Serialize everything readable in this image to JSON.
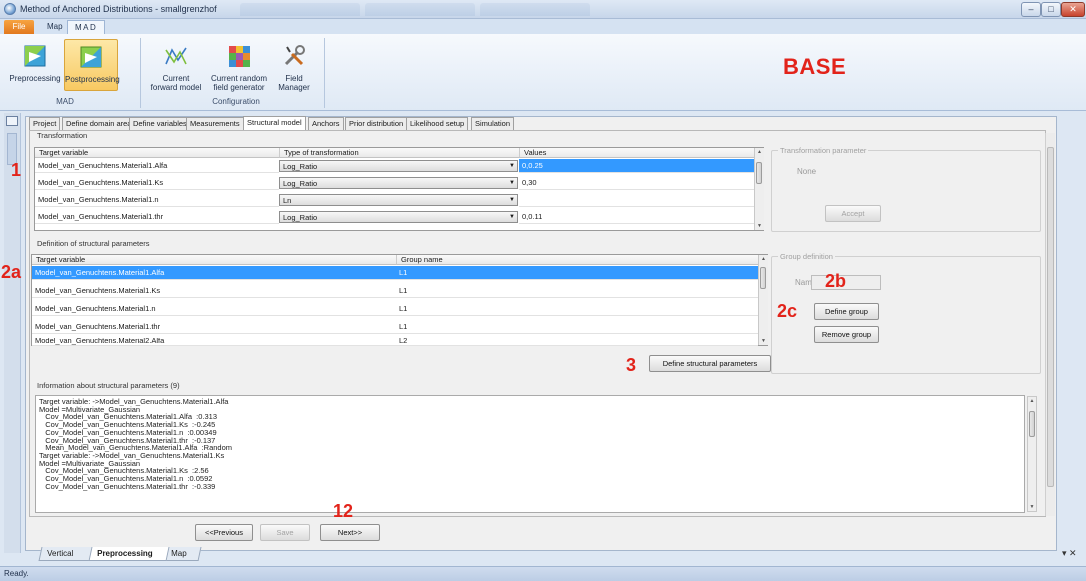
{
  "window": {
    "title": "Method of Anchored Distributions - smallgrenzhof",
    "controls": {
      "minimize": "–",
      "maximize": "□",
      "close": "✕"
    }
  },
  "menu": {
    "file": "File",
    "map": "Map",
    "mad": "MAD"
  },
  "ribbon": {
    "preprocessing": "Preprocessing",
    "postprocessing": "Postprocessing",
    "group_mad": "MAD",
    "current_forward_model_1": "Current",
    "current_forward_model_2": "forward model",
    "current_random_1": "Current random",
    "current_random_2": "field generator",
    "field_manager_1": "Field",
    "field_manager_2": "Manager",
    "group_configuration": "Configuration"
  },
  "overlay": {
    "base": "BASE",
    "lbl_1": "1",
    "lbl_2a": "2a",
    "lbl_2b": "2b",
    "lbl_2c": "2c",
    "lbl_3": "3",
    "lbl_12": "12"
  },
  "tabs": [
    "Project",
    "Define domain area",
    "Define variables",
    "Measurements",
    "Structural model",
    "Anchors",
    "Prior distribution",
    "Likelihood setup",
    "Simulation"
  ],
  "active_tab": "Structural model",
  "transformation": {
    "title": "Transformation",
    "headers": {
      "target": "Target variable",
      "type": "Type of transformation",
      "values": "Values"
    },
    "rows": [
      {
        "target": "Model_van_Genuchtens.Material1.Alfa",
        "type": "Log_Ratio",
        "values": "0,0.25"
      },
      {
        "target": "Model_van_Genuchtens.Material1.Ks",
        "type": "Log_Ratio",
        "values": "0,30"
      },
      {
        "target": "Model_van_Genuchtens.Material1.n",
        "type": "Ln",
        "values": ""
      },
      {
        "target": "Model_van_Genuchtens.Material1.thr",
        "type": "Log_Ratio",
        "values": "0,0.11"
      }
    ]
  },
  "transformation_param": {
    "legend": "Transformation parameter",
    "value": "None",
    "accept": "Accept"
  },
  "structural": {
    "title": "Definition of structural parameters",
    "headers": {
      "target": "Target variable",
      "group": "Group name"
    },
    "rows": [
      {
        "target": "Model_van_Genuchtens.Material1.Alfa",
        "group": "L1"
      },
      {
        "target": "Model_van_Genuchtens.Material1.Ks",
        "group": "L1"
      },
      {
        "target": "Model_van_Genuchtens.Material1.n",
        "group": "L1"
      },
      {
        "target": "Model_van_Genuchtens.Material1.thr",
        "group": "L1"
      },
      {
        "target": "Model_van_Genuchtens.Material2.Alfa",
        "group": "L2"
      }
    ],
    "define_button": "Define structural parameters"
  },
  "group_def": {
    "legend": "Group definition",
    "name_label": "Name",
    "define": "Define group",
    "remove": "Remove group"
  },
  "info": {
    "title": "Information about structural parameters  (9)",
    "lines": [
      "Target variable: ->Model_van_Genuchtens.Material1.Alfa",
      "Model =Multivariate_Gaussian",
      "   Cov_Model_van_Genuchtens.Material1.Alfa  :0.313",
      "   Cov_Model_van_Genuchtens.Material1.Ks  :-0.245",
      "   Cov_Model_van_Genuchtens.Material1.n  :0.00349",
      "   Cov_Model_van_Genuchtens.Material1.thr  :-0.137",
      "   Mean_Model_van_Genuchtens.Material1.Alfa  :Random",
      "Target variable: ->Model_van_Genuchtens.Material1.Ks",
      "Model =Multivariate_Gaussian",
      "   Cov_Model_van_Genuchtens.Material1.Ks  :2.56",
      "   Cov_Model_van_Genuchtens.Material1.n  :0.0592",
      "   Cov_Model_van_Genuchtens.Material1.thr  :-0.339"
    ]
  },
  "nav": {
    "previous": "<<Previous",
    "save": "Save",
    "next": "Next>>"
  },
  "bottom_tabs": [
    "Vertical",
    "Preprocessing",
    "Map"
  ],
  "bottom_close": "▾ ✕",
  "status": "Ready."
}
